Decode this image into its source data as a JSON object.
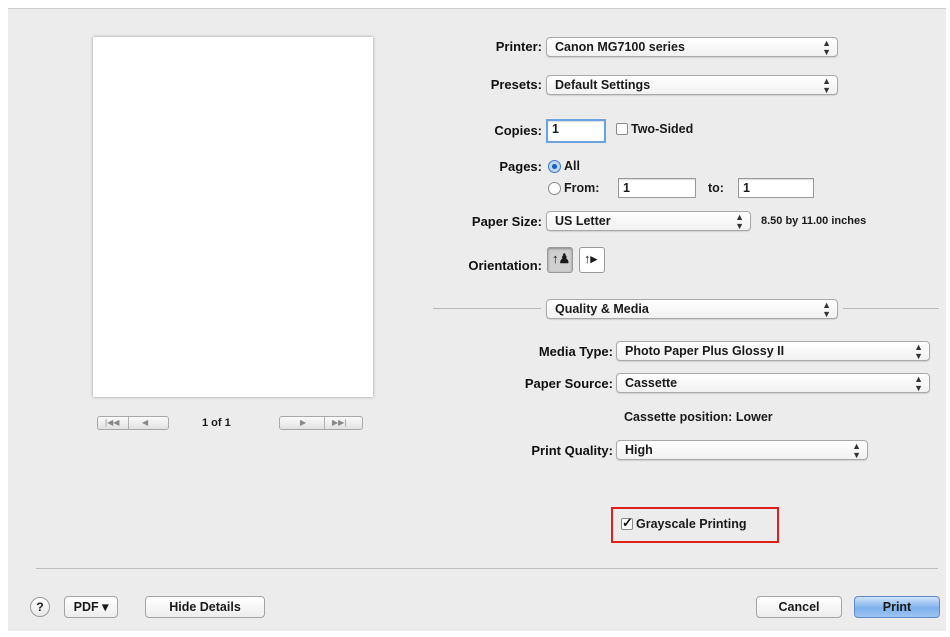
{
  "printer": {
    "label": "Printer:",
    "value": "Canon MG7100 series"
  },
  "presets": {
    "label": "Presets:",
    "value": "Default Settings"
  },
  "copies": {
    "label": "Copies:",
    "value": "1",
    "two_sided": "Two-Sided"
  },
  "pages": {
    "label": "Pages:",
    "all": "All",
    "from": "From:",
    "from_value": "1",
    "to": "to:",
    "to_value": "1"
  },
  "paper_size": {
    "label": "Paper Size:",
    "value": "US Letter",
    "dimensions": "8.50 by 11.00 inches"
  },
  "orientation": {
    "label": "Orientation:"
  },
  "section": {
    "value": "Quality & Media"
  },
  "media_type": {
    "label": "Media Type:",
    "value": "Photo Paper Plus Glossy II"
  },
  "paper_source": {
    "label": "Paper Source:",
    "value": "Cassette",
    "position": "Cassette position: Lower"
  },
  "print_quality": {
    "label": "Print Quality:",
    "value": "High"
  },
  "grayscale": {
    "label": "Grayscale Printing",
    "checked": true,
    "highlight_color": "#e0201b"
  },
  "preview": {
    "page_indicator": "1 of 1"
  },
  "footer": {
    "help": "?",
    "pdf": "PDF ▾",
    "hide_details": "Hide Details",
    "cancel": "Cancel",
    "print": "Print"
  },
  "colors": {
    "accent": "#7fb1ec",
    "dialog_bg": "#ececec"
  }
}
